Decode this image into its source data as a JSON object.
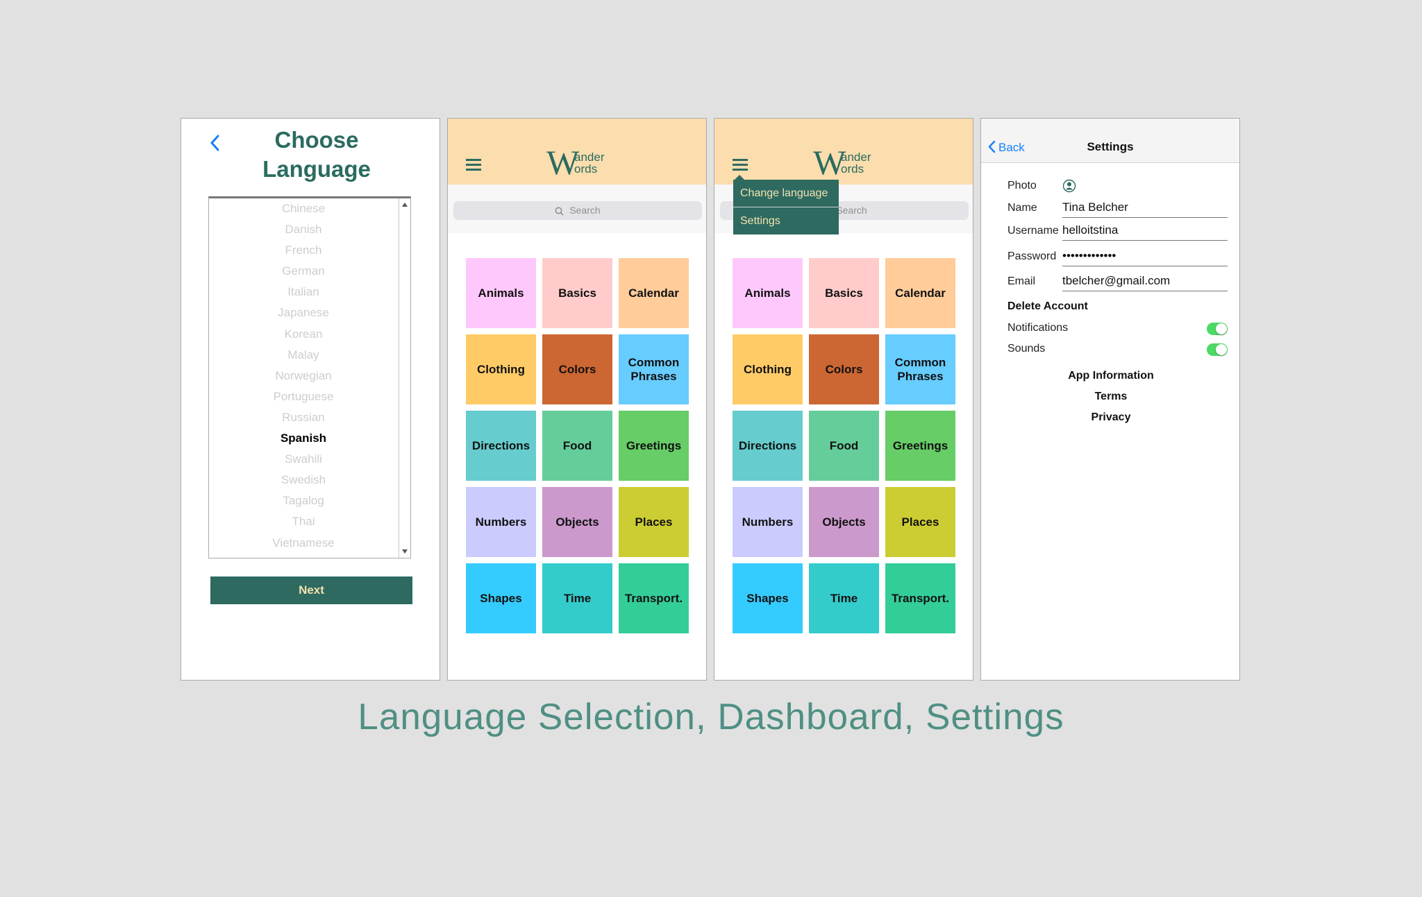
{
  "language_screen": {
    "title_line1": "Choose",
    "title_line2": "Language",
    "languages": [
      "Chinese",
      "Danish",
      "French",
      "German",
      "Italian",
      "Japanese",
      "Korean",
      "Malay",
      "Norwegian",
      "Portuguese",
      "Russian",
      "Spanish",
      "Swahili",
      "Swedish",
      "Tagalog",
      "Thai",
      "Vietnamese"
    ],
    "selected": "Spanish",
    "next_label": "Next"
  },
  "dashboard": {
    "logo_big": "W",
    "logo_line1": "ander",
    "logo_line2": "ords",
    "search_placeholder": "Search",
    "categories": [
      {
        "label": "Animals",
        "color": "#ffc8fd"
      },
      {
        "label": "Basics",
        "color": "#ffcccb"
      },
      {
        "label": "Calendar",
        "color": "#ffcc9a"
      },
      {
        "label": "Clothing",
        "color": "#ffcb67"
      },
      {
        "label": "Colors",
        "color": "#cc6633"
      },
      {
        "label": "Common Phrases",
        "color": "#67ccfe"
      },
      {
        "label": "Directions",
        "color": "#66cccd"
      },
      {
        "label": "Food",
        "color": "#65cd9a"
      },
      {
        "label": "Greetings",
        "color": "#66cd67"
      },
      {
        "label": "Numbers",
        "color": "#cccbfe"
      },
      {
        "label": "Objects",
        "color": "#cb99cc"
      },
      {
        "label": "Places",
        "color": "#cccd32"
      },
      {
        "label": "Shapes",
        "color": "#34ccfe"
      },
      {
        "label": "Time",
        "color": "#33cccb"
      },
      {
        "label": "Transport.",
        "color": "#33cd98"
      }
    ]
  },
  "menu": {
    "items": [
      "Change language",
      "Settings"
    ]
  },
  "settings": {
    "back_label": "Back",
    "title": "Settings",
    "photo_label": "Photo",
    "name_label": "Name",
    "name_value": "Tina Belcher",
    "username_label": "Username",
    "username_value": "helloitstina",
    "password_label": "Password",
    "password_value": "•••••••••••••",
    "email_label": "Email",
    "email_value": "tbelcher@gmail.com",
    "delete_account": "Delete Account",
    "notifications_label": "Notifications",
    "notifications_on": true,
    "sounds_label": "Sounds",
    "sounds_on": true,
    "app_information": "App Information",
    "terms": "Terms",
    "privacy": "Privacy"
  },
  "caption": "Language Selection, Dashboard, Settings",
  "colors": {
    "brand_green": "#2e6a60",
    "header_peach": "#fbddae",
    "ios_blue": "#157efb",
    "toggle_green": "#4cd964"
  }
}
